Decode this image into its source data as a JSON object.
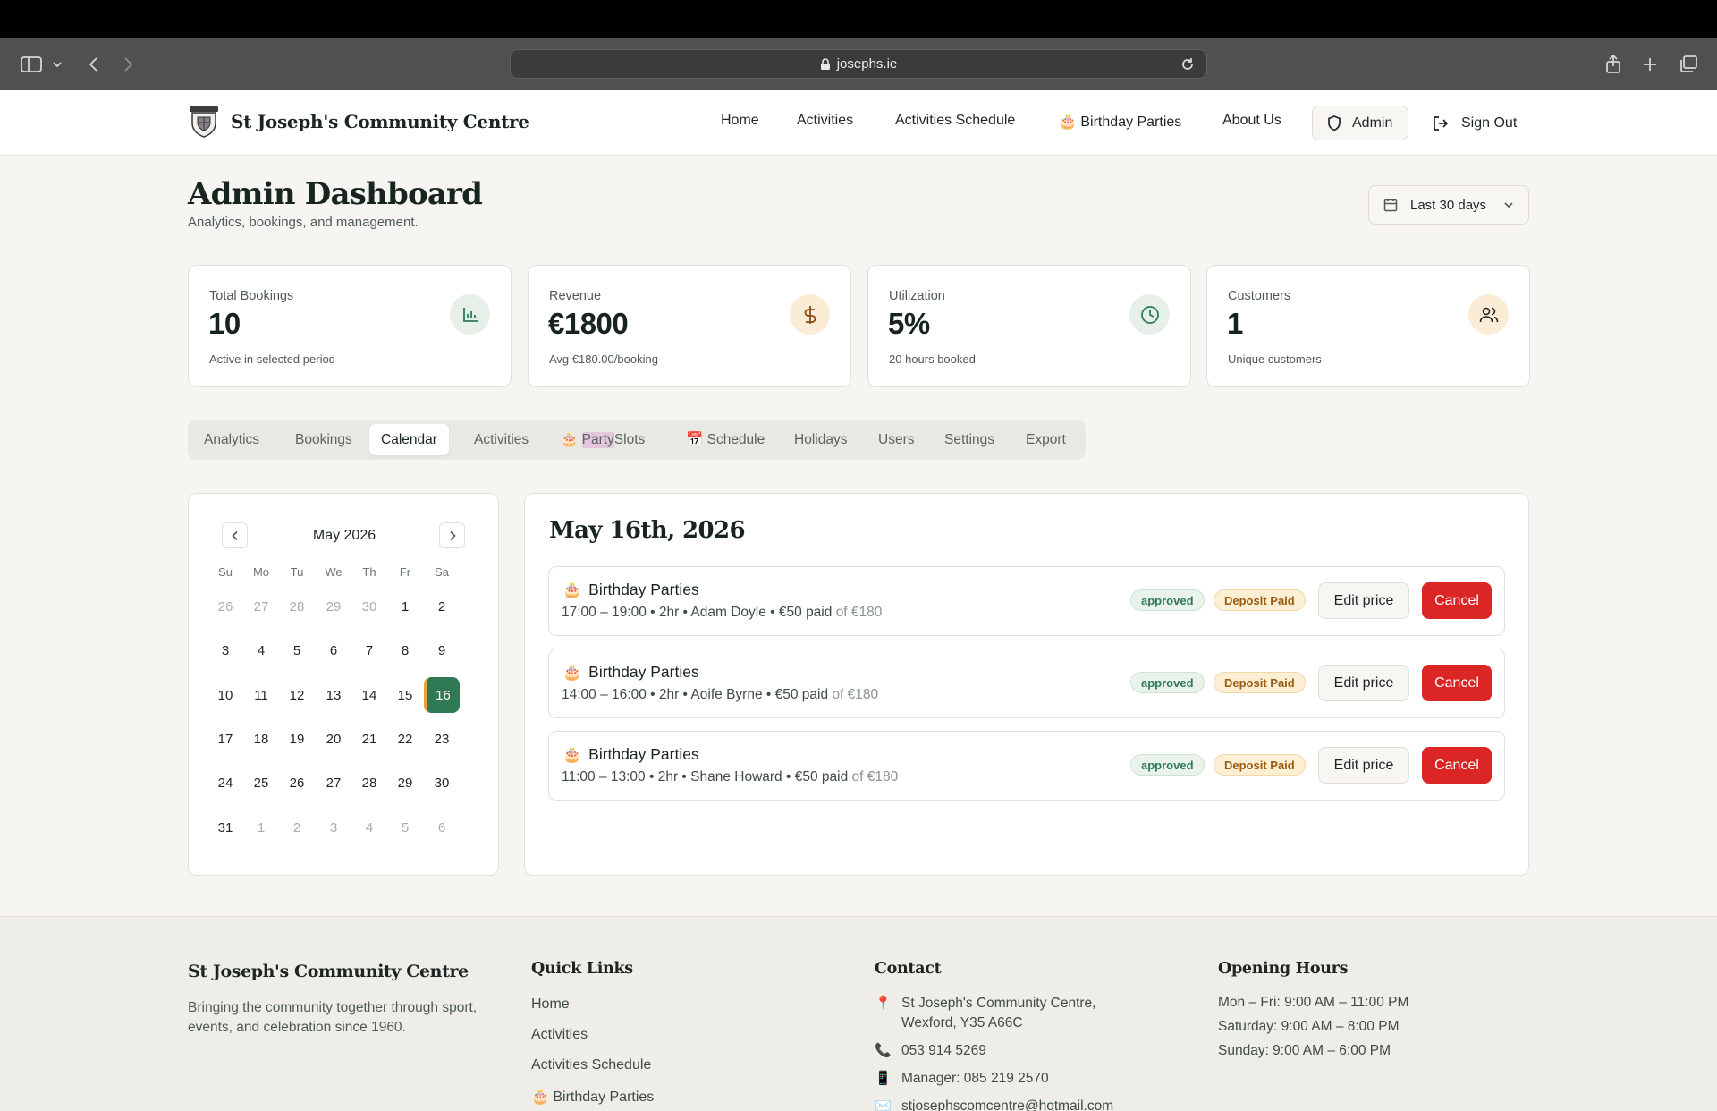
{
  "browser": {
    "url": "josephs.ie"
  },
  "header": {
    "brand": "St Joseph's Community Centre",
    "nav": [
      {
        "label": "Home"
      },
      {
        "label": "Activities"
      },
      {
        "label": "Activities Schedule"
      },
      {
        "label": "🎂 Birthday Parties"
      },
      {
        "label": "About Us"
      }
    ],
    "admin_label": "Admin",
    "signout_label": "Sign Out"
  },
  "dashboard": {
    "title": "Admin Dashboard",
    "subtitle": "Analytics, bookings, and management.",
    "range": "Last 30 days"
  },
  "stats": [
    {
      "label": "Total Bookings",
      "value": "10",
      "note": "Active in selected period",
      "icon": "bar-chart-icon"
    },
    {
      "label": "Revenue",
      "value": "€1800",
      "note": "Avg €180.00/booking",
      "icon": "dollar-icon"
    },
    {
      "label": "Utilization",
      "value": "5%",
      "note": "20 hours booked",
      "icon": "clock-icon"
    },
    {
      "label": "Customers",
      "value": "1",
      "note": "Unique customers",
      "icon": "users-icon"
    }
  ],
  "tabs": [
    {
      "label": "Analytics",
      "active": false
    },
    {
      "label": "Bookings",
      "active": false
    },
    {
      "label": "Calendar",
      "active": true
    },
    {
      "label": "Activities",
      "active": false
    },
    {
      "label": "🎂 ",
      "label_hl": "Party",
      "label_rest": " Slots",
      "active": false
    },
    {
      "label": "📅 Schedule",
      "active": false
    },
    {
      "label": "Holidays",
      "active": false
    },
    {
      "label": "Users",
      "active": false
    },
    {
      "label": "Settings",
      "active": false
    },
    {
      "label": "Export",
      "active": false
    }
  ],
  "calendar": {
    "month": "May 2026",
    "weekdays": [
      "Su",
      "Mo",
      "Tu",
      "We",
      "Th",
      "Fr",
      "Sa"
    ],
    "weeks": [
      [
        "26",
        "27",
        "28",
        "29",
        "30",
        "1",
        "2"
      ],
      [
        "3",
        "4",
        "5",
        "6",
        "7",
        "8",
        "9"
      ],
      [
        "10",
        "11",
        "12",
        "13",
        "14",
        "15",
        "16"
      ],
      [
        "17",
        "18",
        "19",
        "20",
        "21",
        "22",
        "23"
      ],
      [
        "24",
        "25",
        "26",
        "27",
        "28",
        "29",
        "30"
      ],
      [
        "31",
        "1",
        "2",
        "3",
        "4",
        "5",
        "6"
      ]
    ],
    "selected": "16"
  },
  "day": {
    "title": "May 16th, 2026",
    "bookings": [
      {
        "title": "Birthday Parties",
        "meta": "17:00 – 19:00 • 2hr • Adam Doyle • €50 paid",
        "of": "of €180",
        "status": "approved",
        "payment": "Deposit Paid",
        "edit_label": "Edit price",
        "cancel_label": "Cancel"
      },
      {
        "title": "Birthday Parties",
        "meta": "14:00 – 16:00 • 2hr • Aoife Byrne • €50 paid",
        "of": "of €180",
        "status": "approved",
        "payment": "Deposit Paid",
        "edit_label": "Edit price",
        "cancel_label": "Cancel"
      },
      {
        "title": "Birthday Parties",
        "meta": "11:00 – 13:00 • 2hr • Shane Howard • €50 paid",
        "of": "of €180",
        "status": "approved",
        "payment": "Deposit Paid",
        "edit_label": "Edit price",
        "cancel_label": "Cancel"
      }
    ]
  },
  "footer": {
    "brand": "St Joseph's Community Centre",
    "tagline": "Bringing the community together through sport, events, and celebration since 1960.",
    "quick_links_title": "Quick Links",
    "quick_links": [
      "Home",
      "Activities",
      "Activities Schedule",
      "🎂 Birthday Parties"
    ],
    "contact_title": "Contact",
    "contact": [
      {
        "icon": "📍",
        "text1": "St Joseph's Community Centre,",
        "text2": "Wexford, Y35 A66C"
      },
      {
        "icon": "📞",
        "text1": "053 914 5269"
      },
      {
        "icon": "📱",
        "text1": "Manager: 085 219 2570"
      },
      {
        "icon": "✉️",
        "text1": "stjosephscomcentre@hotmail.com"
      }
    ],
    "hours_title": "Opening Hours",
    "hours": [
      "Mon – Fri: 9:00 AM – 11:00 PM",
      "Saturday: 9:00 AM – 8:00 PM",
      "Sunday: 9:00 AM – 6:00 PM"
    ]
  },
  "colors": {
    "accent": "#2f7a55",
    "danger": "#dc2626",
    "background": "#f6f5f1"
  }
}
